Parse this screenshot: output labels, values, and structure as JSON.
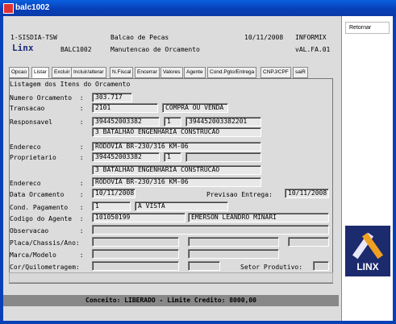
{
  "window": {
    "title": "balc1002"
  },
  "side": {
    "retornar": "Retornar",
    "logo_text": "LINX"
  },
  "header": {
    "system": "1-SISDIA-TSW",
    "program": "BALC1002",
    "brand": "Linx",
    "module": "Balcao de Pecas",
    "screen_title": "Manutencao de Orcamento",
    "date": "10/11/2008",
    "db": "INFORMIX",
    "version": "vAL.FA.01"
  },
  "tabs": [
    "Opcao",
    "Listar",
    "Excluir",
    "Incluir/alterar",
    "N.Fiscal",
    "Encerrar",
    "Valores",
    "Agente",
    "Cond.Pgto/Entrega",
    "CNPJ/CPF",
    "saiR"
  ],
  "section_title": "Listagem dos Itens do Orcamento",
  "form": {
    "numero_orcamento_label": "Numero Orcamento  :",
    "numero_orcamento": "303.717",
    "transacao_label": "Transacao         :",
    "transacao_code": "2101",
    "transacao_desc": "COMPRA OU VENDA",
    "responsavel_label": "Responsavel       :",
    "responsavel_id": "394452003382",
    "responsavel_seq": "1",
    "responsavel_full": "394452003382201",
    "responsavel_nome": "3 BATALHAO ENGENHARIA CONSTRUCAO",
    "endereco_label": "Endereco          :",
    "endereco": "RODOVIA BR-230/316 KM-06",
    "proprietario_label": "Proprietario      :",
    "proprietario_id": "394452003382",
    "proprietario_seq": "1",
    "proprietario_nome": "3 BATALHAO ENGENHARIA CONSTRUCAO",
    "endereco2_label": "Endereco          :",
    "endereco2": "RODOVIA BR-230/316 KM-06",
    "data_orcamento_label": "Data Orcamento    :",
    "data_orcamento": "10/11/2008",
    "previsao_label": "Previsao Entrega:",
    "previsao": "10/11/2008",
    "cond_pagto_label": "Cond. Pagamento   :",
    "cond_pagto_code": "1",
    "cond_pagto_desc": "A VISTA",
    "agente_label": "Codigo do Agente  :",
    "agente_code": "101050199",
    "agente_nome": "EMERSON LEANDRO MINARI",
    "observacao_label": "Observacao        :",
    "placa_label": "Placa/Chassis/Ano:",
    "marca_label": "Marca/Modelo      :",
    "cor_label": "Cor/Quilometragem:",
    "setor_label": "Setor Produtivo:"
  },
  "status_bar": "Conceito: LIBERADO - Limite Credito: 8000,00"
}
